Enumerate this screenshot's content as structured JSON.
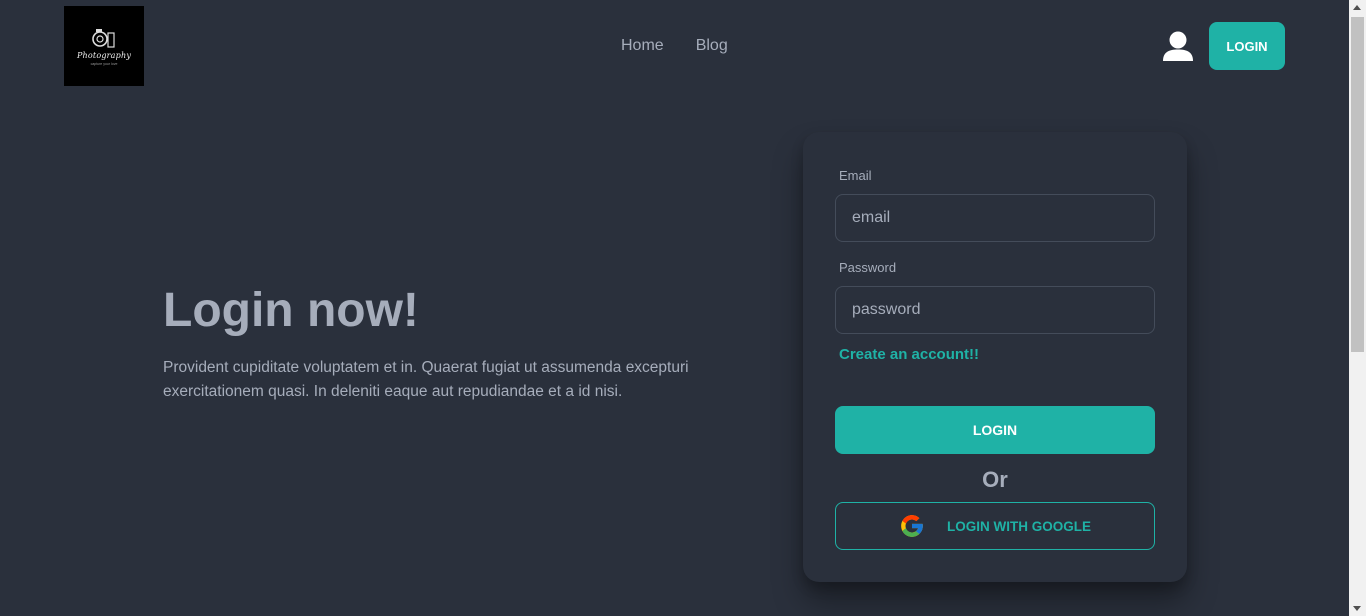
{
  "navbar": {
    "logo": {
      "text": "Photography",
      "tagline": "capture your love",
      "icon": "camera-icon"
    },
    "links": [
      {
        "label": "Home"
      },
      {
        "label": "Blog"
      }
    ],
    "user_icon": "user-icon",
    "login_label": "LOGIN"
  },
  "hero": {
    "title": "Login now!",
    "description": "Provident cupiditate voluptatem et in. Quaerat fugiat ut assumenda excepturi exercitationem quasi. In deleniti eaque aut repudiandae et a id nisi."
  },
  "form": {
    "email_label": "Email",
    "email_placeholder": "email",
    "password_label": "Password",
    "password_placeholder": "password",
    "create_account": "Create an account!!",
    "login_label": "LOGIN",
    "or_text": "Or",
    "google_label": "LOGIN WITH GOOGLE",
    "google_icon": "google-icon"
  },
  "colors": {
    "background": "#2a303c",
    "primary": "#1fb2a6",
    "text": "#a6adbb"
  }
}
